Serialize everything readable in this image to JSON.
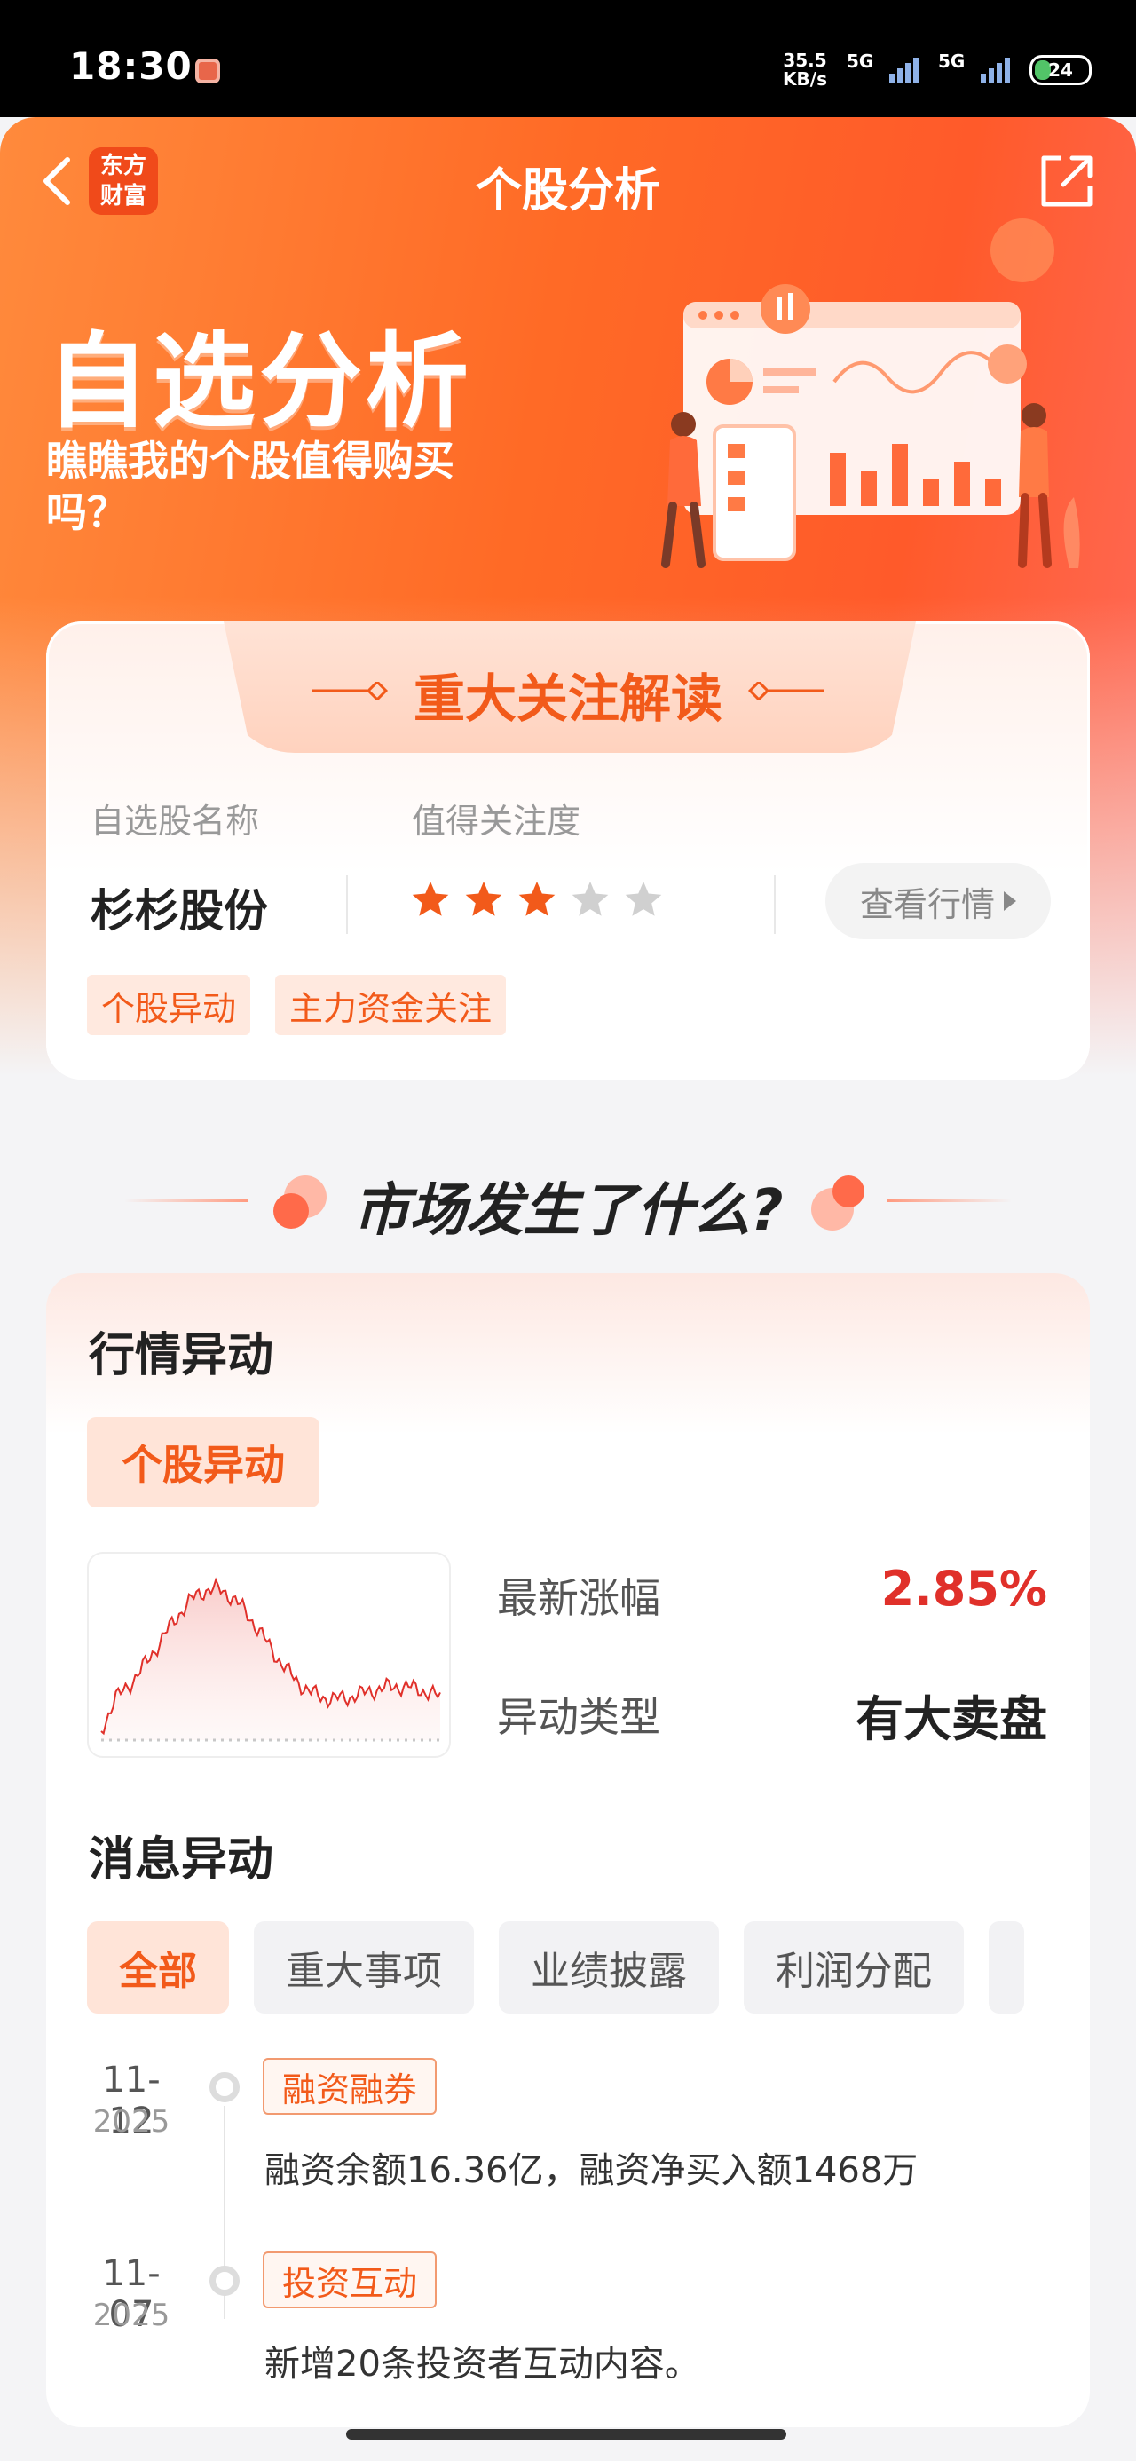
{
  "status_bar": {
    "time": "18:30",
    "net_speed_value": "35.5",
    "net_speed_unit": "KB/s",
    "sim1_label": "5G",
    "sim2_label": "5G",
    "battery": "24"
  },
  "nav": {
    "title": "个股分析",
    "brand_line1": "东方",
    "brand_line2": "财富"
  },
  "hero": {
    "title": "自选分析",
    "subtitle": "瞧瞧我的个股值得购买吗？"
  },
  "focus": {
    "title": "重大关注解读",
    "name_label": "自选股名称",
    "attention_label": "值得关注度",
    "stock_name": "杉杉股份",
    "rating": 3,
    "rating_max": 5,
    "view_button": "查看行情",
    "tags": [
      "个股异动",
      "主力资金关注"
    ]
  },
  "section": {
    "title": "市场发生了什么?"
  },
  "market_move": {
    "heading": "行情异动",
    "pill": "个股异动",
    "latest_change_label": "最新涨幅",
    "latest_change_value": "2.85%",
    "move_type_label": "异动类型",
    "move_type_value": "有大卖盘"
  },
  "news_move": {
    "heading": "消息异动",
    "filters": [
      "全部",
      "重大事项",
      "业绩披露",
      "利润分配"
    ],
    "active_filter": 0,
    "items": [
      {
        "date": "11-12",
        "year": "2025",
        "tag": "融资融券",
        "text": "融资余额16.36亿，融资净买入额1468万"
      },
      {
        "date": "11-07",
        "year": "2025",
        "tag": "投资互动",
        "text": "新增20条投资者互动内容。"
      }
    ]
  },
  "colors": {
    "accent": "#f25a1a",
    "price_up": "#e0302a",
    "star_on": "#f25a1a",
    "star_off": "#d0d0d0"
  }
}
